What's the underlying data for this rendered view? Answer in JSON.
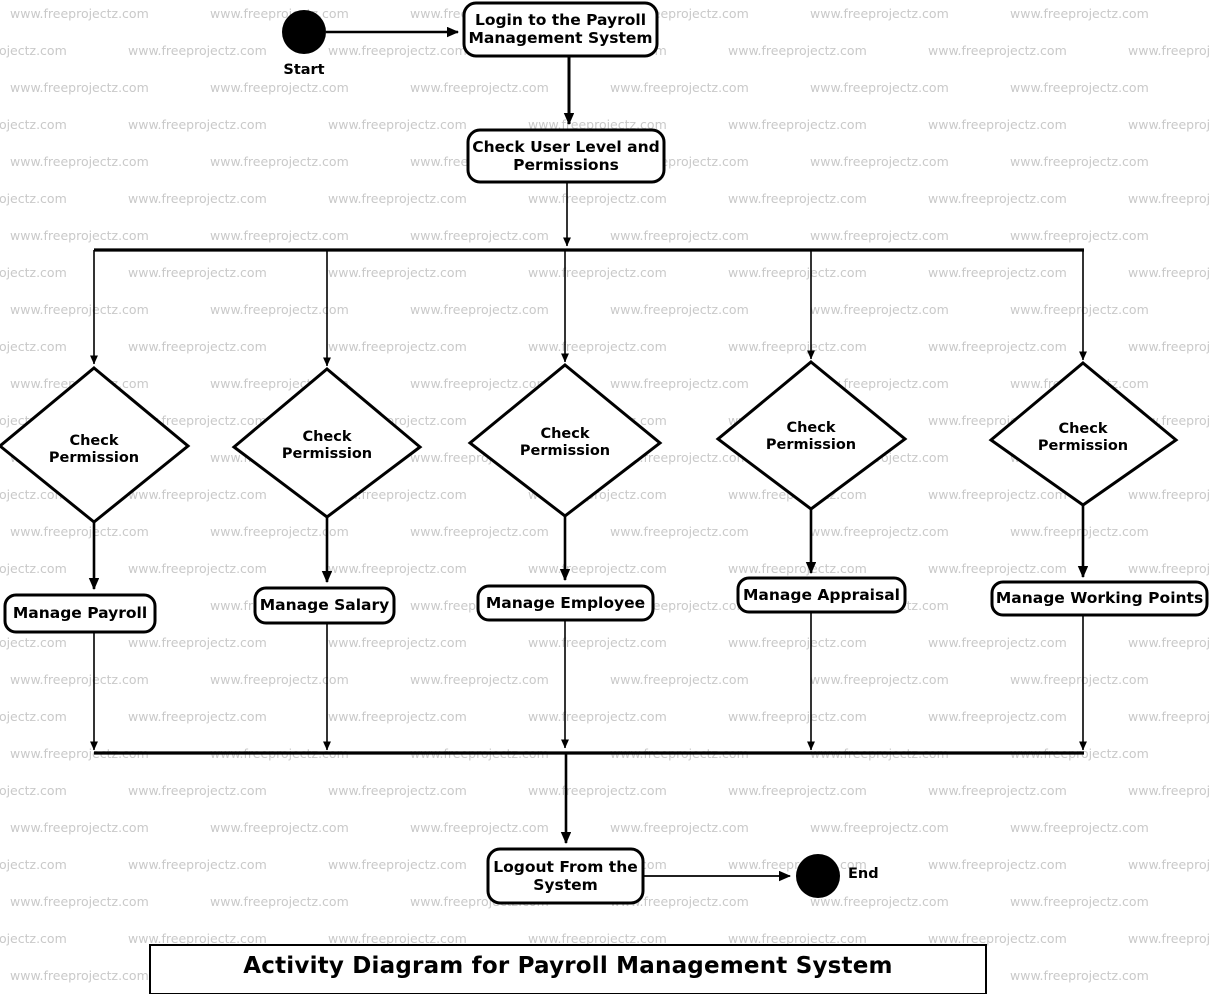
{
  "diagram": {
    "title": "Activity Diagram for Payroll Management System",
    "type": "uml-activity-diagram",
    "colors": {
      "stroke": "#000000",
      "fill": "#ffffff",
      "watermark": "#c9c9c9"
    },
    "watermark": {
      "text": "www.freeprojectz.com"
    },
    "start": {
      "label": "Start"
    },
    "end": {
      "label": "End"
    },
    "actions": {
      "login": "Login to the Payroll\nManagement System",
      "check_user": "Check User Level and\nPermissions",
      "logout": "Logout From the\nSystem"
    },
    "decisions": [
      {
        "label": "Check\nPermission"
      },
      {
        "label": "Check\nPermission"
      },
      {
        "label": "Check\nPermission"
      },
      {
        "label": "Check\nPermission"
      },
      {
        "label": "Check\nPermission"
      }
    ],
    "branch_actions": [
      {
        "label": "Manage Payroll"
      },
      {
        "label": "Manage Salary"
      },
      {
        "label": "Manage Employee"
      },
      {
        "label": "Manage Appraisal"
      },
      {
        "label": "Manage Working Points"
      }
    ]
  }
}
